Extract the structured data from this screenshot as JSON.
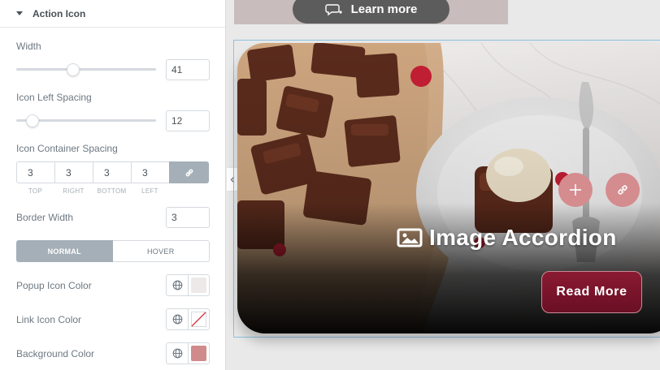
{
  "panel": {
    "section_title": "Action Icon",
    "width": {
      "label": "Width",
      "value": "41",
      "slider_fraction": 0.41
    },
    "icon_left_spacing": {
      "label": "Icon Left Spacing",
      "value": "12",
      "slider_fraction": 0.12
    },
    "icon_container_spacing": {
      "label": "Icon Container Spacing",
      "values": [
        "3",
        "3",
        "3",
        "3"
      ],
      "sides": [
        "TOP",
        "RIGHT",
        "BOTTOM",
        "LEFT"
      ]
    },
    "border_width": {
      "label": "Border Width",
      "value": "3"
    },
    "state_tabs": {
      "normal": "NORMAL",
      "hover": "HOVER",
      "active": "normal"
    },
    "popup_icon_color": {
      "label": "Popup Icon Color",
      "color": "#ece9e8"
    },
    "link_icon_color": {
      "label": "Link Icon Color",
      "color": "none"
    },
    "background_color": {
      "label": "Background Color",
      "color": "#d08a8c"
    }
  },
  "canvas": {
    "learn_more_label": "Learn more",
    "accordion_title": "Image Accordion",
    "read_more_label": "Read More"
  },
  "colors": {
    "panel_bg": "#ffffff",
    "canvas_bg": "#e9e9e9",
    "action_circle": "#d48c8e",
    "read_more_bg": "#7a1429",
    "selection_outline": "#8ec2e0"
  },
  "icons": [
    "caret-down-icon",
    "link-icon",
    "globe-icon",
    "chevron-left-icon",
    "chat-icon",
    "image-icon",
    "plus-icon"
  ]
}
